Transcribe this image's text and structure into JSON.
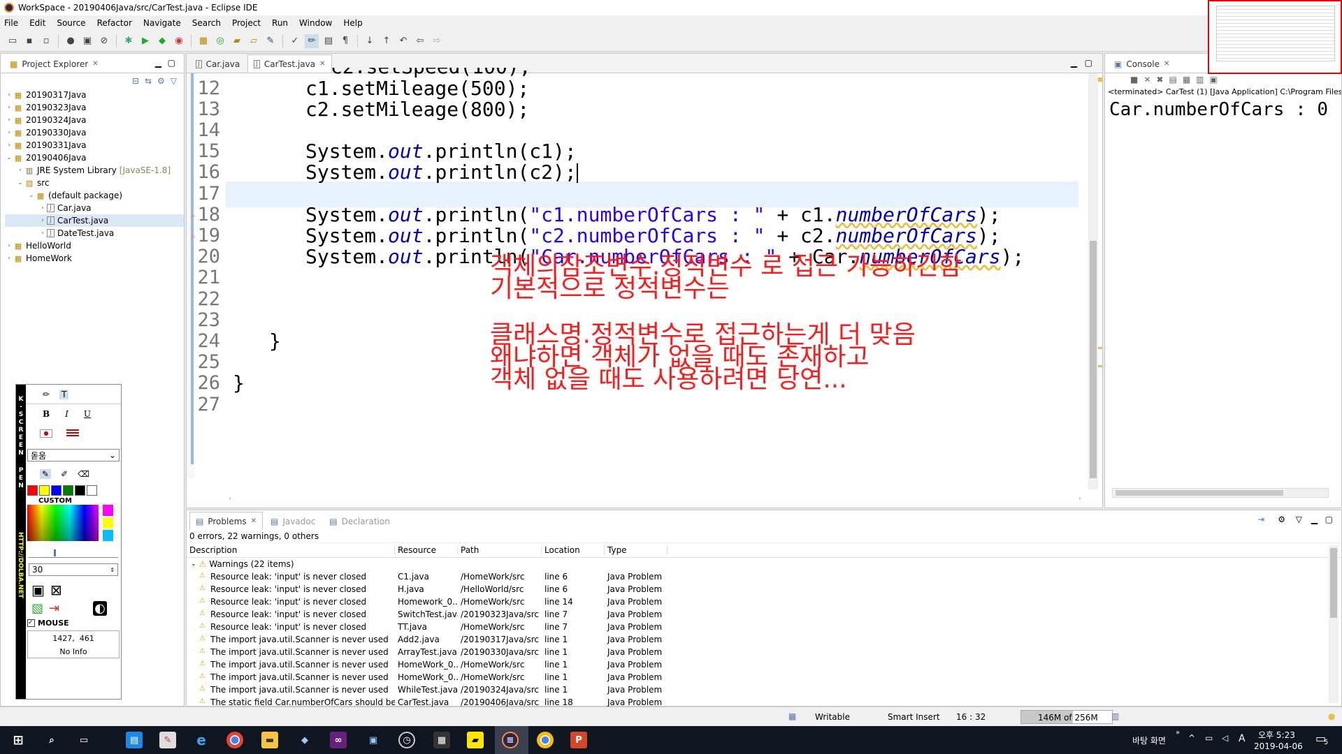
{
  "window": {
    "title": "WorkSpace - 20190406Java/src/CarTest.java - Eclipse IDE"
  },
  "menu": [
    "File",
    "Edit",
    "Source",
    "Refactor",
    "Navigate",
    "Search",
    "Project",
    "Run",
    "Window",
    "Help"
  ],
  "project_explorer": {
    "title": "Project Explorer",
    "items": [
      {
        "label": "20190317Java",
        "indent": 0,
        "open": false,
        "type": "project"
      },
      {
        "label": "20190323Java",
        "indent": 0,
        "open": false,
        "type": "project"
      },
      {
        "label": "20190324Java",
        "indent": 0,
        "open": false,
        "type": "project"
      },
      {
        "label": "20190330Java",
        "indent": 0,
        "open": false,
        "type": "project"
      },
      {
        "label": "20190331Java",
        "indent": 0,
        "open": false,
        "type": "project"
      },
      {
        "label": "20190406Java",
        "indent": 0,
        "open": true,
        "type": "project"
      },
      {
        "label": "JRE System Library",
        "suffix": "[JavaSE-1.8]",
        "indent": 1,
        "open": false,
        "type": "lib"
      },
      {
        "label": "src",
        "indent": 1,
        "open": true,
        "type": "src"
      },
      {
        "label": "(default package)",
        "indent": 2,
        "open": true,
        "type": "pkg"
      },
      {
        "label": "Car.java",
        "indent": 3,
        "open": false,
        "type": "file"
      },
      {
        "label": "CarTest.java",
        "indent": 3,
        "open": false,
        "type": "file",
        "selected": true
      },
      {
        "label": "DateTest.java",
        "indent": 3,
        "open": false,
        "type": "file"
      },
      {
        "label": "HelloWorld",
        "indent": 0,
        "open": false,
        "type": "project"
      },
      {
        "label": "HomeWork",
        "indent": 0,
        "open": false,
        "type": "project"
      }
    ]
  },
  "editor": {
    "tabs": [
      {
        "label": "Car.java",
        "active": false
      },
      {
        "label": "CarTest.java",
        "active": true
      }
    ],
    "lines": [
      {
        "n": "12",
        "code": "c1.setMileage(500);",
        "indent": 2
      },
      {
        "n": "13",
        "code": "c2.setMileage(800);",
        "indent": 2
      },
      {
        "n": "14",
        "code": "",
        "indent": 0
      },
      {
        "n": "15",
        "pre": "System.",
        "field": "out",
        "post": ".println(c1);",
        "indent": 2
      },
      {
        "n": "16",
        "pre": "System.",
        "field": "out",
        "post": ".println(c2);",
        "indent": 2
      },
      {
        "n": "17",
        "code": "",
        "indent": 0
      },
      {
        "n": "18",
        "pre": "System.",
        "field": "out",
        "post": ".println(",
        "str": "\"c1.numberOfCars : \"",
        "post2": " + c1.",
        "field2": "numberOfCars",
        "post3": ");",
        "indent": 2,
        "warn": true
      },
      {
        "n": "19",
        "pre": "System.",
        "field": "out",
        "post": ".println(",
        "str": "\"c2.numberOfCars : \"",
        "post2": " + c2.",
        "field2": "numberOfCars",
        "post3": ");",
        "indent": 2,
        "warn": true
      },
      {
        "n": "20",
        "pre": "System.",
        "field": "out",
        "post": ".println(",
        "str": "\"Car.numberOfCars : \"",
        "post2": " + Car.",
        "field2": "numberOfCars",
        "post3": ");",
        "indent": 2
      },
      {
        "n": "21",
        "code": "",
        "indent": 0
      },
      {
        "n": "22",
        "code": "",
        "indent": 0
      },
      {
        "n": "23",
        "code": "",
        "indent": 0
      },
      {
        "n": "24",
        "code": "}",
        "indent": 1
      },
      {
        "n": "25",
        "code": "",
        "indent": 0
      },
      {
        "n": "26",
        "code": "}",
        "indent": 0
      },
      {
        "n": "27",
        "code": "",
        "indent": 0
      }
    ],
    "annotations": [
      "객체의참조변수.정적변수 로 접근 가능하긴함",
      "기본적으로 정적변수는",
      "클래스명.정적변수로 접근하는게 더 맞음",
      "왜냐하면 객체가 없을 때도 존재하고",
      "객체 없을 때도 사용하려면 당연..."
    ]
  },
  "console": {
    "title": "Console",
    "status": "<terminated> CarTest (1) [Java Application] C:\\Program Files",
    "output": "Car.numberOfCars : 0"
  },
  "problems": {
    "tabs": [
      {
        "label": "Problems",
        "active": true
      },
      {
        "label": "Javadoc",
        "active": false
      },
      {
        "label": "Declaration",
        "active": false
      }
    ],
    "summary": "0 errors, 22 warnings, 0 others",
    "columns": [
      "Description",
      "Resource",
      "Path",
      "Location",
      "Type"
    ],
    "group": "Warnings (22 items)",
    "rows": [
      [
        "Resource leak: 'input' is never closed",
        "C1.java",
        "/HomeWork/src",
        "line 6",
        "Java Problem"
      ],
      [
        "Resource leak: 'input' is never closed",
        "H.java",
        "/HelloWorld/src",
        "line 6",
        "Java Problem"
      ],
      [
        "Resource leak: 'input' is never closed",
        "Homework_0...",
        "/HomeWork/src",
        "line 14",
        "Java Problem"
      ],
      [
        "Resource leak: 'input' is never closed",
        "SwitchTest.java",
        "/20190323Java/src",
        "line 7",
        "Java Problem"
      ],
      [
        "Resource leak: 'input' is never closed",
        "TT.java",
        "/HomeWork/src",
        "line 7",
        "Java Problem"
      ],
      [
        "The import java.util.Scanner is never used",
        "Add2.java",
        "/20190317Java/src",
        "line 1",
        "Java Problem"
      ],
      [
        "The import java.util.Scanner is never used",
        "ArrayTest.java",
        "/20190330Java/src",
        "line 1",
        "Java Problem"
      ],
      [
        "The import java.util.Scanner is never used",
        "HomeWork_0...",
        "/HomeWork/src",
        "line 1",
        "Java Problem"
      ],
      [
        "The import java.util.Scanner is never used",
        "HomeWork_0...",
        "/HomeWork/src",
        "line 1",
        "Java Problem"
      ],
      [
        "The import java.util.Scanner is never used",
        "WhileTest.java",
        "/20190324Java/src",
        "line 1",
        "Java Problem"
      ],
      [
        "The static field Car.numberOfCars should be",
        "CarTest.java",
        "/20190406Java/src",
        "line 18",
        "Java Problem"
      ]
    ]
  },
  "statusbar": {
    "writable": "Writable",
    "insert": "Smart Insert",
    "position": "16 : 32",
    "heap": "146M of 256M",
    "heap_used_fraction": 0.57
  },
  "screenpen": {
    "letters": "K-SCREEN PEN",
    "bold": "B",
    "italic": "I",
    "underline": "U",
    "font": "돋움",
    "custom": "CUSTOM",
    "size": "30",
    "mouse_label": "MOUSE",
    "coords": "1427,  461",
    "info": "No Info",
    "url": "HTTP://DOLBA.NET",
    "colors": [
      "#ff0000",
      "#ffff00",
      "#0000ff",
      "#008000",
      "#000000",
      "#ffffff"
    ],
    "extra_colors": [
      "#ff00ff",
      "#ffff00",
      "#00bfff"
    ]
  },
  "taskbar": {
    "desktop_label": "바탕 화면",
    "ime": "A",
    "time": "오후 5:23",
    "date": "2019-04-06",
    "notification_count": "5"
  }
}
